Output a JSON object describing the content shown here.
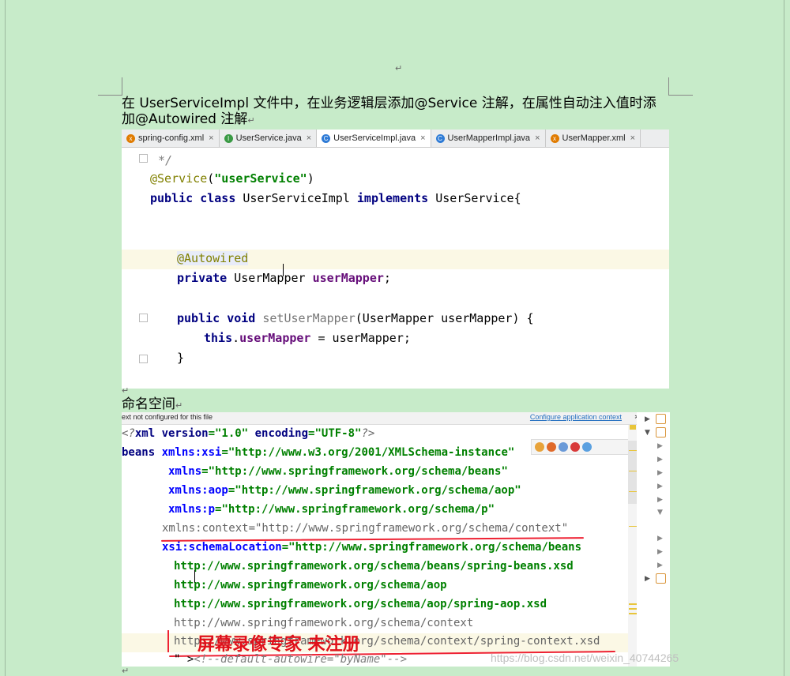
{
  "page": {
    "para_mark": "↵",
    "intro_line1": "在 UserServiceImpl 文件中，在业务逻辑层添加@Service 注解，在属性自动注入值时添",
    "intro_line2": "加@Autowired 注解",
    "section_heading": "命名空间"
  },
  "tabs": [
    {
      "label": "spring-config.xml",
      "icon_color": "#e07b00",
      "icon_glyph": "x"
    },
    {
      "label": "UserService.java",
      "icon_color": "#3a9a45",
      "icon_glyph": "I"
    },
    {
      "label": "UserServiceImpl.java",
      "icon_color": "#2e7bd6",
      "icon_glyph": "C",
      "active": true
    },
    {
      "label": "UserMapperImpl.java",
      "icon_color": "#2e7bd6",
      "icon_glyph": "C"
    },
    {
      "label": "UserMapper.xml",
      "icon_color": "#e07b00",
      "icon_glyph": "x"
    }
  ],
  "tab_close": "×",
  "java": {
    "l1": "*/",
    "l2_ann": "@Service",
    "l2_open": "(",
    "l2_str": "\"userService\"",
    "l2_close": ")",
    "l3_kw1": "public class",
    "l3_name": "UserServiceImpl",
    "l3_kw2": "implements",
    "l3_iface": "UserService{",
    "l4_ann": "@Autowired",
    "l5_kw": "private",
    "l5_type": "UserMapper",
    "l5_field": "userMapper",
    "l5_end": ";",
    "l6_kw": "public void",
    "l6_name": "setUserMapper",
    "l6_params": "(UserMapper userMapper) {",
    "l7_kw": "this",
    "l7_dot": ".",
    "l7_field": "userMapper",
    "l7_rest": " = userMapper;",
    "l8": "}"
  },
  "xml": {
    "notice_left": "ext not configured for this file",
    "notice_right": "Configure application context",
    "notice_gear": "✲▾",
    "x1a": "<?",
    "x1b": "xml version",
    "x1c": "=\"1.0\" ",
    "x1d": "encoding",
    "x1e": "=\"UTF-8\"",
    "x1f": "?>",
    "x2a": "beans ",
    "x2b": "xmlns:xsi",
    "x2c": "=\"http://www.w3.org/2001/XMLSchema-instance\"",
    "x3a": "xmlns",
    "x3b": "=\"http://www.springframework.org/schema/beans\"",
    "x4a": "xmlns:aop",
    "x4b": "=\"http://www.springframework.org/schema/aop\"",
    "x5a": "xmlns:p",
    "x5b": "=\"http://www.springframework.org/schema/p\"",
    "x6": "xmlns:context=\"http://www.springframework.org/schema/context\"",
    "x7a": "xsi:schemaLocation",
    "x7b": "=\"http://www.springframework.org/schema/beans",
    "x8": "http://www.springframework.org/schema/beans/spring-beans.xsd",
    "x9": "http://www.springframework.org/schema/aop",
    "x10": "http://www.springframework.org/schema/aop/spring-aop.xsd",
    "x11": "http://www.springframework.org/schema/context",
    "x12": "http://www.springframework.org/schema/context/spring-context.xsd",
    "x13a": "\" >",
    "x13b": "<!--default-autowire=\"byName\"-->"
  },
  "watermark": {
    "recorder": "屏幕录像专家  未注册",
    "url": "https://blog.csdn.net/weixin_40744265"
  },
  "colors": {
    "page_bg": "#c7ebc9",
    "keyword": "#000080",
    "annotation": "#808000",
    "string": "#008000",
    "field": "#660e7a",
    "red_mark": "#e23"
  }
}
